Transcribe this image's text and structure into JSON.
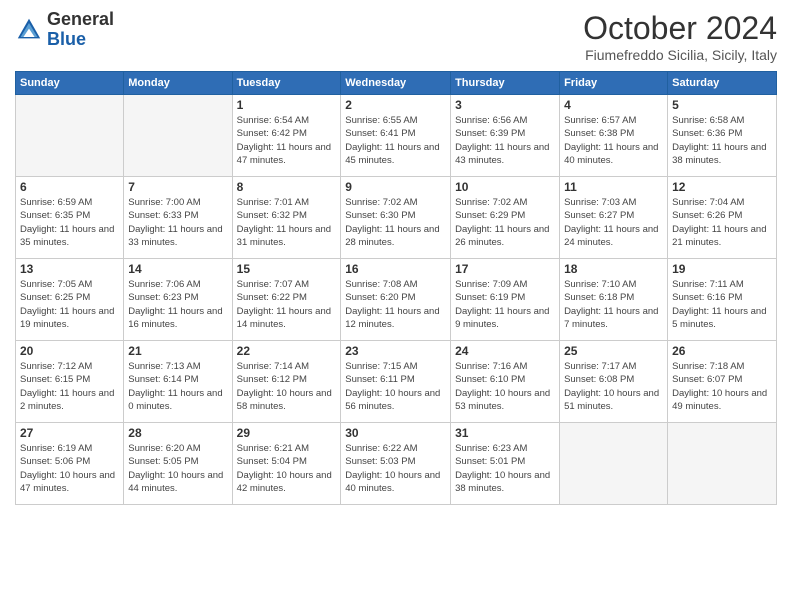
{
  "logo": {
    "general": "General",
    "blue": "Blue"
  },
  "header": {
    "month": "October 2024",
    "location": "Fiumefreddo Sicilia, Sicily, Italy"
  },
  "weekdays": [
    "Sunday",
    "Monday",
    "Tuesday",
    "Wednesday",
    "Thursday",
    "Friday",
    "Saturday"
  ],
  "weeks": [
    [
      {
        "day": "",
        "info": ""
      },
      {
        "day": "",
        "info": ""
      },
      {
        "day": "1",
        "info": "Sunrise: 6:54 AM\nSunset: 6:42 PM\nDaylight: 11 hours and 47 minutes."
      },
      {
        "day": "2",
        "info": "Sunrise: 6:55 AM\nSunset: 6:41 PM\nDaylight: 11 hours and 45 minutes."
      },
      {
        "day": "3",
        "info": "Sunrise: 6:56 AM\nSunset: 6:39 PM\nDaylight: 11 hours and 43 minutes."
      },
      {
        "day": "4",
        "info": "Sunrise: 6:57 AM\nSunset: 6:38 PM\nDaylight: 11 hours and 40 minutes."
      },
      {
        "day": "5",
        "info": "Sunrise: 6:58 AM\nSunset: 6:36 PM\nDaylight: 11 hours and 38 minutes."
      }
    ],
    [
      {
        "day": "6",
        "info": "Sunrise: 6:59 AM\nSunset: 6:35 PM\nDaylight: 11 hours and 35 minutes."
      },
      {
        "day": "7",
        "info": "Sunrise: 7:00 AM\nSunset: 6:33 PM\nDaylight: 11 hours and 33 minutes."
      },
      {
        "day": "8",
        "info": "Sunrise: 7:01 AM\nSunset: 6:32 PM\nDaylight: 11 hours and 31 minutes."
      },
      {
        "day": "9",
        "info": "Sunrise: 7:02 AM\nSunset: 6:30 PM\nDaylight: 11 hours and 28 minutes."
      },
      {
        "day": "10",
        "info": "Sunrise: 7:02 AM\nSunset: 6:29 PM\nDaylight: 11 hours and 26 minutes."
      },
      {
        "day": "11",
        "info": "Sunrise: 7:03 AM\nSunset: 6:27 PM\nDaylight: 11 hours and 24 minutes."
      },
      {
        "day": "12",
        "info": "Sunrise: 7:04 AM\nSunset: 6:26 PM\nDaylight: 11 hours and 21 minutes."
      }
    ],
    [
      {
        "day": "13",
        "info": "Sunrise: 7:05 AM\nSunset: 6:25 PM\nDaylight: 11 hours and 19 minutes."
      },
      {
        "day": "14",
        "info": "Sunrise: 7:06 AM\nSunset: 6:23 PM\nDaylight: 11 hours and 16 minutes."
      },
      {
        "day": "15",
        "info": "Sunrise: 7:07 AM\nSunset: 6:22 PM\nDaylight: 11 hours and 14 minutes."
      },
      {
        "day": "16",
        "info": "Sunrise: 7:08 AM\nSunset: 6:20 PM\nDaylight: 11 hours and 12 minutes."
      },
      {
        "day": "17",
        "info": "Sunrise: 7:09 AM\nSunset: 6:19 PM\nDaylight: 11 hours and 9 minutes."
      },
      {
        "day": "18",
        "info": "Sunrise: 7:10 AM\nSunset: 6:18 PM\nDaylight: 11 hours and 7 minutes."
      },
      {
        "day": "19",
        "info": "Sunrise: 7:11 AM\nSunset: 6:16 PM\nDaylight: 11 hours and 5 minutes."
      }
    ],
    [
      {
        "day": "20",
        "info": "Sunrise: 7:12 AM\nSunset: 6:15 PM\nDaylight: 11 hours and 2 minutes."
      },
      {
        "day": "21",
        "info": "Sunrise: 7:13 AM\nSunset: 6:14 PM\nDaylight: 11 hours and 0 minutes."
      },
      {
        "day": "22",
        "info": "Sunrise: 7:14 AM\nSunset: 6:12 PM\nDaylight: 10 hours and 58 minutes."
      },
      {
        "day": "23",
        "info": "Sunrise: 7:15 AM\nSunset: 6:11 PM\nDaylight: 10 hours and 56 minutes."
      },
      {
        "day": "24",
        "info": "Sunrise: 7:16 AM\nSunset: 6:10 PM\nDaylight: 10 hours and 53 minutes."
      },
      {
        "day": "25",
        "info": "Sunrise: 7:17 AM\nSunset: 6:08 PM\nDaylight: 10 hours and 51 minutes."
      },
      {
        "day": "26",
        "info": "Sunrise: 7:18 AM\nSunset: 6:07 PM\nDaylight: 10 hours and 49 minutes."
      }
    ],
    [
      {
        "day": "27",
        "info": "Sunrise: 6:19 AM\nSunset: 5:06 PM\nDaylight: 10 hours and 47 minutes."
      },
      {
        "day": "28",
        "info": "Sunrise: 6:20 AM\nSunset: 5:05 PM\nDaylight: 10 hours and 44 minutes."
      },
      {
        "day": "29",
        "info": "Sunrise: 6:21 AM\nSunset: 5:04 PM\nDaylight: 10 hours and 42 minutes."
      },
      {
        "day": "30",
        "info": "Sunrise: 6:22 AM\nSunset: 5:03 PM\nDaylight: 10 hours and 40 minutes."
      },
      {
        "day": "31",
        "info": "Sunrise: 6:23 AM\nSunset: 5:01 PM\nDaylight: 10 hours and 38 minutes."
      },
      {
        "day": "",
        "info": ""
      },
      {
        "day": "",
        "info": ""
      }
    ]
  ]
}
